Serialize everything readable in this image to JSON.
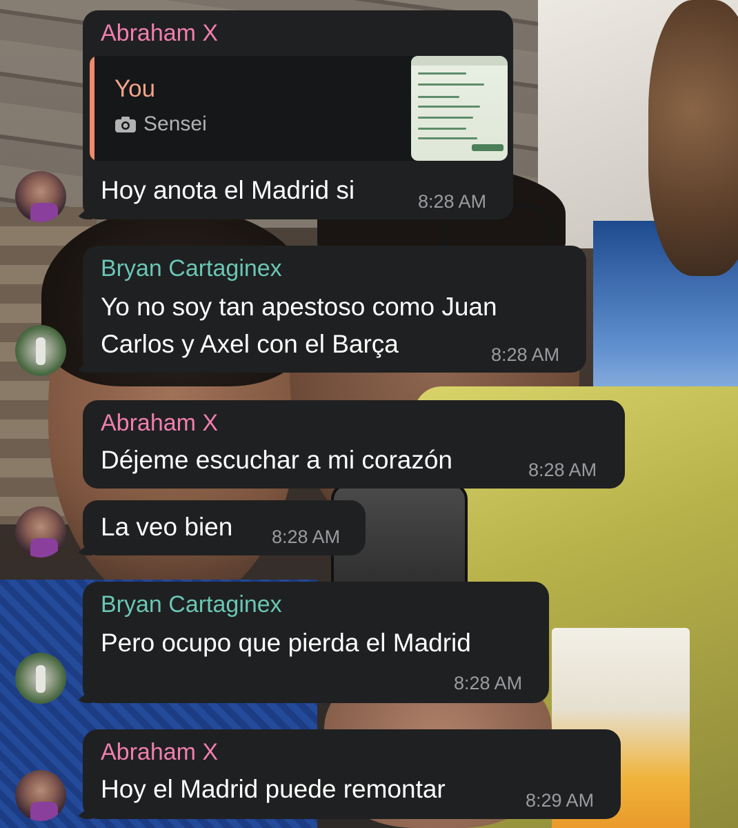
{
  "colors": {
    "bubble_bg": "#1f2021",
    "sender_pink": "#f07fae",
    "sender_teal": "#6ac6b5",
    "reply_accent": "#f08a6c",
    "timestamp": "#9a9ca0"
  },
  "messages": [
    {
      "sender": "Abraham X",
      "reply": {
        "name": "You",
        "icon": "camera-icon",
        "text": "Sensei"
      },
      "text": "Hoy anota el Madrid si",
      "time": "8:28 AM"
    },
    {
      "sender": "Bryan Cartaginex",
      "text_line1": "Yo no soy tan apestoso como Juan",
      "text_line2": "Carlos y Axel con el Barça",
      "time": "8:28 AM"
    },
    {
      "sender": "Abraham X",
      "text": "Déjeme escuchar a mi corazón",
      "time": "8:28 AM"
    },
    {
      "text": "La veo bien",
      "time": "8:28 AM"
    },
    {
      "sender": "Bryan Cartaginex",
      "text": "Pero ocupo que pierda el Madrid",
      "time": "8:28 AM"
    },
    {
      "sender": "Abraham X",
      "text": "Hoy el Madrid puede remontar",
      "time": "8:29 AM"
    }
  ]
}
